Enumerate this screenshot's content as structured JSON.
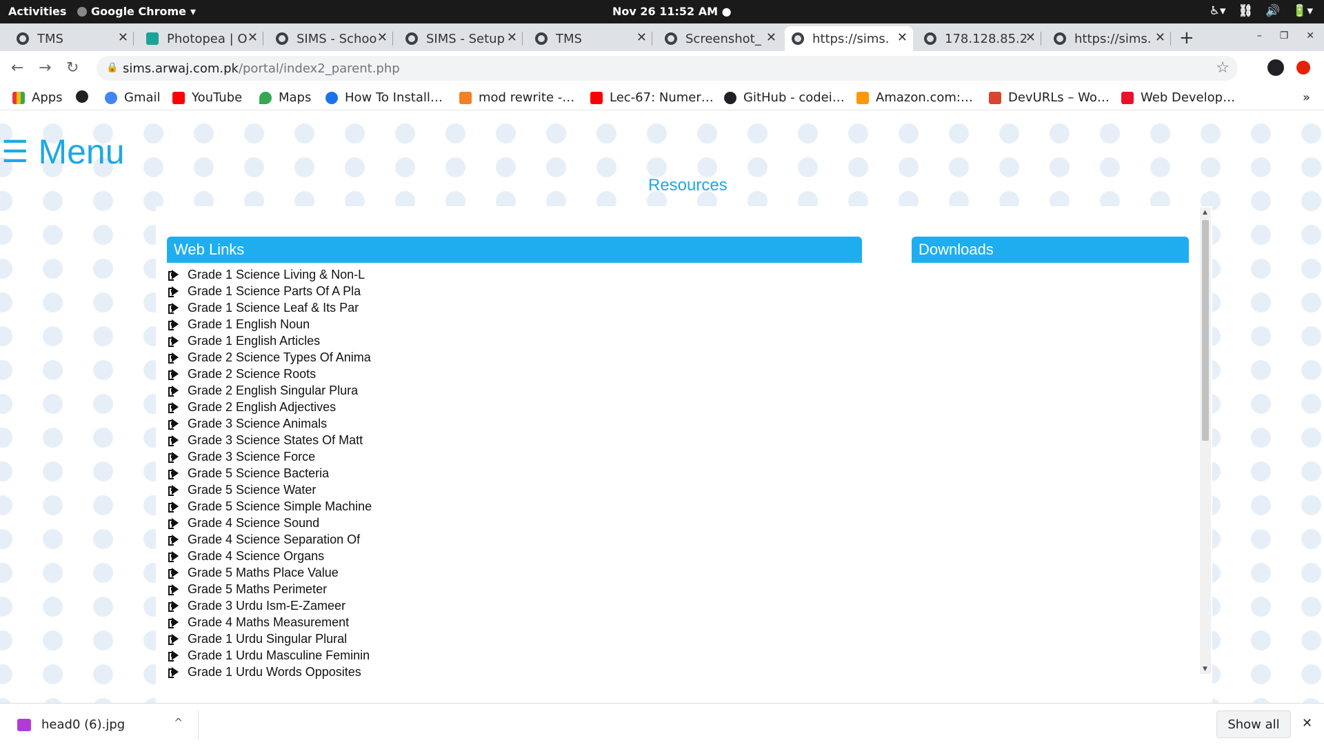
{
  "system_bar": {
    "activities": "Activities",
    "app_name": "Google Chrome",
    "app_menu_arrow": "▾",
    "clock": "Nov 26  11:52 AM ●",
    "tray": [
      "♿▾",
      "⛓",
      "🔊",
      "🔋▾"
    ]
  },
  "tabs": [
    {
      "title": "TMS",
      "icon": "globe-icon",
      "active": false
    },
    {
      "title": "Photopea | O",
      "icon": "photopea-icon",
      "active": false
    },
    {
      "title": "SIMS - Schoo",
      "icon": "globe-icon",
      "active": false
    },
    {
      "title": "SIMS - Setup",
      "icon": "globe-icon",
      "active": false
    },
    {
      "title": "TMS",
      "icon": "globe-icon",
      "active": false
    },
    {
      "title": "Screenshot_",
      "icon": "globe-icon",
      "active": false
    },
    {
      "title": "https://sims.",
      "icon": "globe-icon",
      "active": true
    },
    {
      "title": "178.128.85.2",
      "icon": "globe-icon",
      "active": false
    },
    {
      "title": "https://sims.",
      "icon": "globe-icon",
      "active": false
    }
  ],
  "tab_close_glyph": "✕",
  "new_tab_glyph": "+",
  "window_controls": [
    "–",
    "❐",
    "✕"
  ],
  "toolbar": {
    "back": "←",
    "forward": "→",
    "reload": "↻",
    "url_host": "sims.arwaj.com.pk",
    "url_path": "/portal/index2_parent.php",
    "star": "☆",
    "lock": "🔒"
  },
  "bookmarks": [
    {
      "label": "Apps",
      "color": "#e53935"
    },
    {
      "label": "",
      "color": "#202124"
    },
    {
      "label": "Gmail",
      "color": "#4285f4"
    },
    {
      "label": "YouTube",
      "color": "#ff0000"
    },
    {
      "label": "Maps",
      "color": "#34a853"
    },
    {
      "label": "How To Install…",
      "color": "#1a73e8"
    },
    {
      "label": "mod rewrite -…",
      "color": "#f48024"
    },
    {
      "label": "Lec-67: Numer…",
      "color": "#ff0000"
    },
    {
      "label": "GitHub - codei…",
      "color": "#202124"
    },
    {
      "label": "Amazon.com:…",
      "color": "#ff9900"
    },
    {
      "label": "DevURLs – Wo…",
      "color": "#d9452f"
    },
    {
      "label": "Web Develop…",
      "color": "#e8122d"
    }
  ],
  "bookmarks_more": "»",
  "page": {
    "menu_glyph": "☰",
    "menu_label": "Menu",
    "resources_title": "Resources",
    "weblinks_header": "Web Links",
    "downloads_header": "Downloads",
    "links": [
      "Grade 1 Science Living & Non-L",
      "Grade 1 Science Parts Of A Pla",
      "Grade 1 Science Leaf & Its Par",
      "Grade 1 English Noun",
      "Grade 1 English Articles",
      "Grade 2 Science Types Of Anima",
      "Grade 2 Science Roots",
      "Grade 2 English Singular Plura",
      "Grade 2 English Adjectives",
      "Grade 3 Science Animals",
      "Grade 3 Science States Of Matt",
      "Grade 3 Science Force",
      "Grade 5 Science Bacteria",
      "Grade 5 Science Water",
      "Grade 5 Science Simple Machine",
      "Grade 4 Science Sound",
      "Grade 4 Science Separation Of",
      "Grade 4 Science Organs",
      "Grade 5 Maths Place Value",
      "Grade 5 Maths Perimeter",
      "Grade 3 Urdu Ism-E-Zameer",
      "Grade 4 Maths Measurement",
      "Grade 1 Urdu Singular Plural",
      "Grade 1 Urdu Masculine Feminin",
      "Grade 1 Urdu Words Opposites"
    ],
    "scroll_up": "▲",
    "scroll_down": "▼"
  },
  "download_shelf": {
    "file_name": "head0 (6).jpg",
    "chevron": "^",
    "show_all": "Show all",
    "close": "✕"
  },
  "colors": {
    "accent": "#1ea8e6",
    "header_bar": "#1eaef0"
  }
}
